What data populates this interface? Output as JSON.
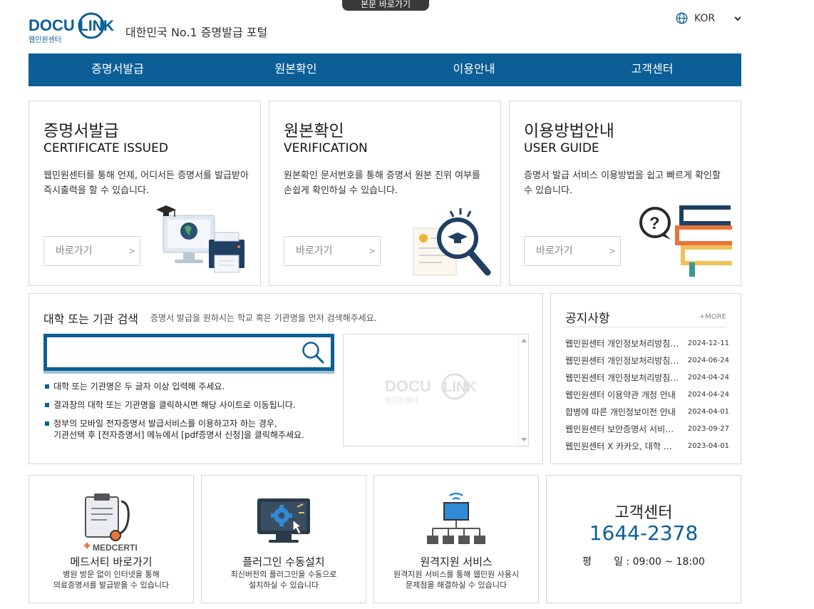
{
  "header": {
    "skip_link": "본문 바로가기",
    "logo_wordmark": "DOCU LINK",
    "logo_sub": "웹민원센터",
    "tagline": "대한민국 No.1 증명발급 포털",
    "language": "KOR"
  },
  "nav": {
    "items": [
      {
        "label": "증명서발급"
      },
      {
        "label": "원본확인"
      },
      {
        "label": "이용안내"
      },
      {
        "label": "고객센터"
      }
    ]
  },
  "services": [
    {
      "title_ko": "증명서발급",
      "title_en": "CERTIFICATE ISSUED",
      "desc": "웹민원센터를 통해 언제, 어디서든 증명서를 발급받아 즉시출력을 할 수 있습니다.",
      "button": "바로가기",
      "button_arrow": ">"
    },
    {
      "title_ko": "원본확인",
      "title_en": "VERIFICATION",
      "desc": "원본확인 문서번호를 통해 증명서 원본 진위 여부를 손쉽게 확인하실 수 있습니다.",
      "button": "바로가기",
      "button_arrow": ">"
    },
    {
      "title_ko": "이용방법안내",
      "title_en": "USER GUIDE",
      "desc": "증명서 발급 서비스 이용방법을 쉽고 빠르게 확인할 수 있습니다.",
      "button": "바로가기",
      "button_arrow": ">"
    }
  ],
  "search": {
    "title": "대학 또는 기관 검색",
    "subtitle": "증명서 발급을 원하시는 학교 혹은 기관명을 먼저 검색해주세요.",
    "input_value": "",
    "input_placeholder": "",
    "tips": [
      "대학 또는 기관명은 두 글자 이상 입력해 주세요.",
      "결과창의 대학 또는 기관명을 클릭하시면 해당 사이트로 이동됩니다.",
      "정부의 모바일 전자증명서 발급서비스를 이용하고자 하는 경우,",
      "기관선택 후 [전자증명서] 메뉴에서 [pdf증명서 신청]을 클릭해주세요."
    ]
  },
  "notice": {
    "title": "공지사항",
    "more": "+MORE",
    "items": [
      {
        "title": "웹민원센터 개인정보처리방침 개정 안내",
        "date": "2024-12-11"
      },
      {
        "title": "웹민원센터 개인정보처리방침 개정 안내",
        "date": "2024-06-24"
      },
      {
        "title": "웹민원센터 개인정보처리방침 개정 안내",
        "date": "2024-04-24"
      },
      {
        "title": "웹민원센터 이용약관 개정 안내",
        "date": "2024-04-24"
      },
      {
        "title": "합병에 따른 개인정보이전 안내",
        "date": "2024-04-01"
      },
      {
        "title": "웹민원센터 보안증명서 서비스 안내",
        "date": "2023-09-27"
      },
      {
        "title": "웹민원센터 X 카카오, 대학 증명서 발급",
        "date": "2023-04-01"
      }
    ]
  },
  "bottom": [
    {
      "badge": "MEDCERTI",
      "title": "메드서티 바로가기",
      "desc1": "병원 방문 없이 인터넷을 통해",
      "desc2": "의료증명서를 발급받을 수 있습니다"
    },
    {
      "title": "플러그인 수동설치",
      "desc1": "최신버전의 플러그인을 수동으로",
      "desc2": "설치하실 수 있습니다"
    },
    {
      "title": "원격지원 서비스",
      "desc1": "원격지원 서비스를 통해 웹민원 사용시",
      "desc2": "문제점을 해결하실 수 있습니다"
    }
  ],
  "customer_center": {
    "title": "고객센터",
    "phone": "1644-2378",
    "hours": "평       일 : 09:00 ~ 18:00"
  },
  "colors": {
    "brand": "#0b5e96",
    "accent": "#e8743b"
  }
}
